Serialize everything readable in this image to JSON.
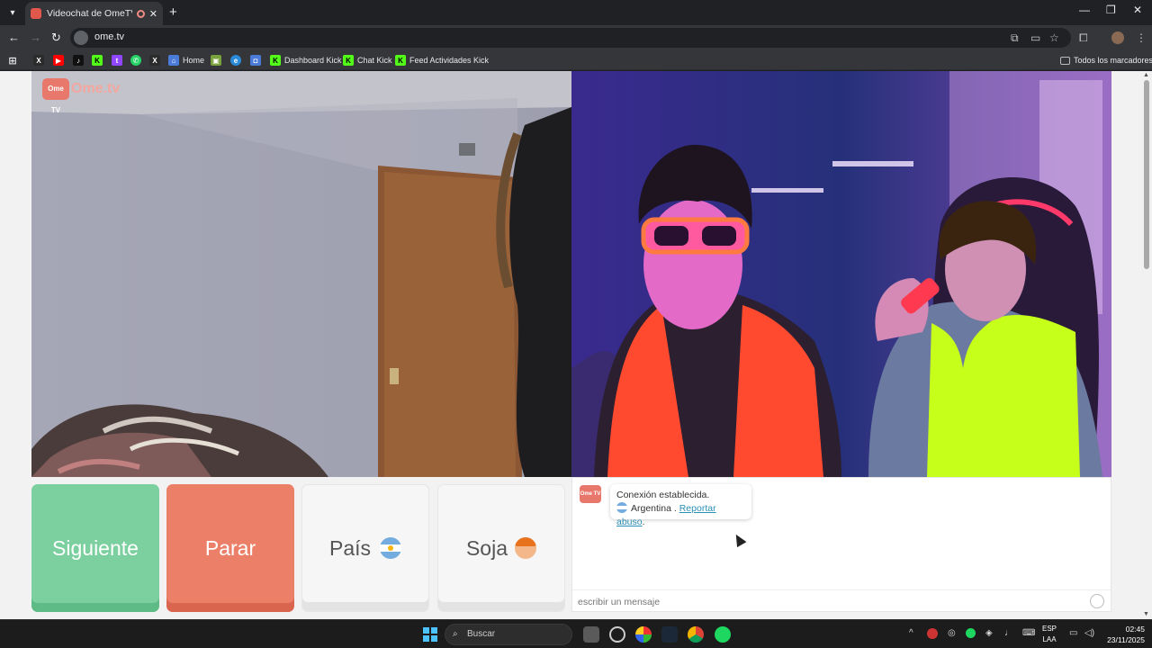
{
  "browser": {
    "tab_title": "Videochat de OmeTV: uno a",
    "tab_close": "✕",
    "new_tab": "+",
    "url": "ome.tv",
    "window_controls": [
      "—",
      "❐",
      "✕"
    ],
    "bookmarks": [
      {
        "label": "",
        "icon": "x-icon",
        "color": "#2b2b2b"
      },
      {
        "label": "",
        "icon": "youtube-icon",
        "color": "#ff0000"
      },
      {
        "label": "",
        "icon": "tiktok-icon",
        "color": "#111111"
      },
      {
        "label": "",
        "icon": "kick-icon",
        "color": "#53fc18"
      },
      {
        "label": "",
        "icon": "twitch-icon",
        "color": "#9146ff"
      },
      {
        "label": "",
        "icon": "whatsapp-icon",
        "color": "#25d366"
      },
      {
        "label": "",
        "icon": "x-icon",
        "color": "#2b2b2b"
      },
      {
        "label": "Home",
        "icon": "home-icon",
        "color": "#4a7bd8"
      },
      {
        "label": "",
        "icon": "image-icon",
        "color": "#7aa23c"
      },
      {
        "label": "",
        "icon": "edge-icon",
        "color": "#2a8ad8"
      },
      {
        "label": "",
        "icon": "app-icon",
        "color": "#4a7bd8"
      },
      {
        "label": "Dashboard Kick",
        "icon": "kick-icon",
        "color": "#53fc18"
      },
      {
        "label": "Chat Kick",
        "icon": "kick-icon",
        "color": "#53fc18"
      },
      {
        "label": "Feed Actividades Kick",
        "icon": "kick-icon",
        "color": "#53fc18"
      }
    ],
    "all_bookmarks": "Todos los marcadores"
  },
  "ometv": {
    "logo_tv": "Ome TV",
    "logo_text": "Ome.tv",
    "buttons": {
      "next": "Siguiente",
      "stop": "Parar",
      "country": "País",
      "gender": "Soja"
    },
    "chat": {
      "message_line1": "Conexión establecida.",
      "country": "Argentina",
      "separator": " . ",
      "report": "Reportar abuso",
      "report_suffix": ".",
      "input_placeholder": "escribir un mensaje"
    }
  },
  "taskbar": {
    "search_label": "Buscar",
    "lang_line1": "ESP",
    "lang_line2": "LAA",
    "time": "02:45",
    "date": "23/11/2025"
  },
  "colors": {
    "next": "#7ccf9f",
    "stop": "#ec7f68",
    "brand": "#e9786c",
    "link": "#2b8fb3"
  }
}
